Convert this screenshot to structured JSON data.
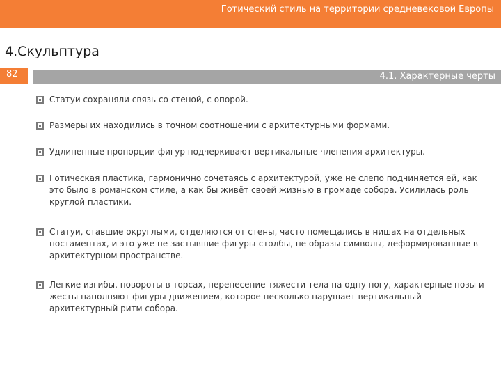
{
  "header": {
    "title": "Готический стиль на территории средневековой Европы"
  },
  "section": {
    "title": "4.Скульптура"
  },
  "page": {
    "number": "82"
  },
  "subtitle": {
    "text": "4.1. Характерные черты"
  },
  "bullets": [
    {
      "text": "Статуи сохраняли связь со стеной, с опорой."
    },
    {
      "text": "Размеры их находились в точном соотношении с архитектурными формами."
    },
    {
      "text": "Удлиненные пропорции фигур подчеркивают вертикальные членения архитектуры."
    },
    {
      "text": "Готическая пластика, гармонично сочетаясь с архитектурой, уже не слепо подчиняется ей, как это было в романском стиле, а как бы живёт своей жизнью в громаде собора. Усилилась роль круглой пластики."
    },
    {
      "text": "Статуи, ставшие округлыми, отделяются от стены, часто помещались в нишах на отдельных постаментах, и это уже не застывшие фигуры-столбы, не образы-символы, деформированные в архитектурном пространстве."
    },
    {
      "text": "Легкие изгибы, повороты в торсах, перенесение тяжести тела на одну ногу, характерные позы и жесты наполняют фигуры движением, которое несколько нарушает вертикальный архитектурный ритм собора."
    }
  ],
  "colors": {
    "accent": "#f47e35",
    "subtitle_bar": "#a5a5a5",
    "bullet_icon": "#7a7a7a"
  },
  "icons": {
    "bullet": "checkbox-bullet-icon"
  }
}
